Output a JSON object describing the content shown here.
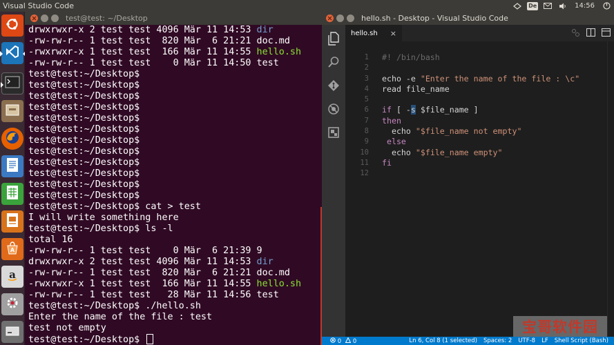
{
  "top_panel": {
    "title": "Visual Studio Code",
    "keyboard_layout": "De",
    "clock": "14:56"
  },
  "launcher": {
    "items": [
      {
        "name": "ubuntu-dash",
        "color": "#dd4814",
        "icon": "ubuntu-icon"
      },
      {
        "name": "vscode",
        "color": "#1c74b9",
        "icon": "vscode-icon"
      },
      {
        "name": "terminal",
        "color": "#2b2b2b",
        "icon": "terminal-icon"
      },
      {
        "name": "files",
        "color": "#8b6f4e",
        "icon": "files-icon"
      },
      {
        "name": "firefox",
        "color": "#e66000",
        "icon": "firefox-icon"
      },
      {
        "name": "writer",
        "color": "#3b79c2",
        "icon": "writer-icon"
      },
      {
        "name": "calc",
        "color": "#3ba33b",
        "icon": "calc-icon"
      },
      {
        "name": "impress",
        "color": "#d8731b",
        "icon": "impress-icon"
      },
      {
        "name": "software-center",
        "color": "#e06a1a",
        "icon": "software-center-icon"
      },
      {
        "name": "amazon",
        "color": "#d9d9d9",
        "icon": "amazon-icon"
      },
      {
        "name": "settings",
        "color": "#a0a0a0",
        "icon": "settings-icon"
      },
      {
        "name": "drive",
        "color": "#707070",
        "icon": "drive-icon"
      }
    ]
  },
  "terminal": {
    "title": "test@test: ~/Desktop",
    "lines": [
      [
        {
          "t": "drwxrwxr-x 2 test test 4096 Mär 11 14:53 "
        },
        {
          "t": "dir",
          "c": "blue"
        }
      ],
      [
        {
          "t": "-rw-rw-r-- 1 test test  820 Mär  6 21:21 doc.md"
        }
      ],
      [
        {
          "t": "-rwxrwxr-x 1 test test  166 Mär 11 14:55 "
        },
        {
          "t": "hello.sh",
          "c": "green"
        }
      ],
      [
        {
          "t": "-rw-rw-r-- 1 test test    0 Mär 11 14:50 test"
        }
      ],
      [
        {
          "t": "test@test:~/Desktop$"
        }
      ],
      [
        {
          "t": "test@test:~/Desktop$"
        }
      ],
      [
        {
          "t": "test@test:~/Desktop$"
        }
      ],
      [
        {
          "t": "test@test:~/Desktop$"
        }
      ],
      [
        {
          "t": "test@test:~/Desktop$"
        }
      ],
      [
        {
          "t": "test@test:~/Desktop$"
        }
      ],
      [
        {
          "t": "test@test:~/Desktop$"
        }
      ],
      [
        {
          "t": "test@test:~/Desktop$"
        }
      ],
      [
        {
          "t": "test@test:~/Desktop$"
        }
      ],
      [
        {
          "t": "test@test:~/Desktop$"
        }
      ],
      [
        {
          "t": "test@test:~/Desktop$"
        }
      ],
      [
        {
          "t": "test@test:~/Desktop$"
        }
      ],
      [
        {
          "t": "test@test:~/Desktop$ cat > test"
        }
      ],
      [
        {
          "t": "I will write something here"
        }
      ],
      [
        {
          "t": "test@test:~/Desktop$ ls -l"
        }
      ],
      [
        {
          "t": "total 16"
        }
      ],
      [
        {
          "t": "-rw-rw-r-- 1 test test    0 Mär  6 21:39 9"
        }
      ],
      [
        {
          "t": "drwxrwxr-x 2 test test 4096 Mär 11 14:53 "
        },
        {
          "t": "dir",
          "c": "blue"
        }
      ],
      [
        {
          "t": "-rw-rw-r-- 1 test test  820 Mär  6 21:21 doc.md"
        }
      ],
      [
        {
          "t": "-rwxrwxr-x 1 test test  166 Mär 11 14:55 "
        },
        {
          "t": "hello.sh",
          "c": "green"
        }
      ],
      [
        {
          "t": "-rw-rw-r-- 1 test test   28 Mär 11 14:56 test"
        }
      ],
      [
        {
          "t": "test@test:~/Desktop$ ./hello.sh"
        }
      ],
      [
        {
          "t": "Enter the name of the file : test"
        }
      ],
      [
        {
          "t": "test not empty"
        }
      ],
      [
        {
          "t": "test@test:~/Desktop$ "
        }
      ]
    ]
  },
  "vscode": {
    "title": "hello.sh - Desktop - Visual Studio Code",
    "tab_label": "hello.sh",
    "tab_close": "×",
    "code_lines": [
      {
        "n": "1",
        "parts": [
          {
            "t": "#! /bin/bash",
            "c": "cmt"
          }
        ]
      },
      {
        "n": "2",
        "parts": []
      },
      {
        "n": "3",
        "parts": [
          {
            "t": "echo -e "
          },
          {
            "t": "\"Enter the name of the file : \\c\"",
            "c": "str"
          }
        ]
      },
      {
        "n": "4",
        "parts": [
          {
            "t": "read file_name"
          }
        ]
      },
      {
        "n": "5",
        "parts": []
      },
      {
        "n": "6",
        "parts": [
          {
            "t": "if",
            "c": "kw"
          },
          {
            "t": " [ -"
          },
          {
            "t": "s",
            "c": "sel"
          },
          {
            "t": " $file_name ]"
          }
        ]
      },
      {
        "n": "7",
        "parts": [
          {
            "t": "then",
            "c": "kw"
          }
        ]
      },
      {
        "n": "8",
        "parts": [
          {
            "t": "  echo "
          },
          {
            "t": "\"$file_name not empty\"",
            "c": "str"
          }
        ]
      },
      {
        "n": "9",
        "parts": [
          {
            "t": " "
          },
          {
            "t": "else",
            "c": "kw"
          }
        ]
      },
      {
        "n": "10",
        "parts": [
          {
            "t": "  echo "
          },
          {
            "t": "\"$file_name empty\"",
            "c": "str"
          }
        ]
      },
      {
        "n": "11",
        "parts": [
          {
            "t": "fi",
            "c": "kw"
          }
        ]
      },
      {
        "n": "12",
        "parts": []
      }
    ],
    "status": {
      "errors": "0",
      "warnings": "0",
      "position": "Ln 6, Col 8 (1 selected)",
      "spaces": "Spaces: 2",
      "encoding": "UTF-8",
      "eol": "LF",
      "language": "Shell Script (Bash)"
    }
  },
  "watermark": "宝哥软件园"
}
